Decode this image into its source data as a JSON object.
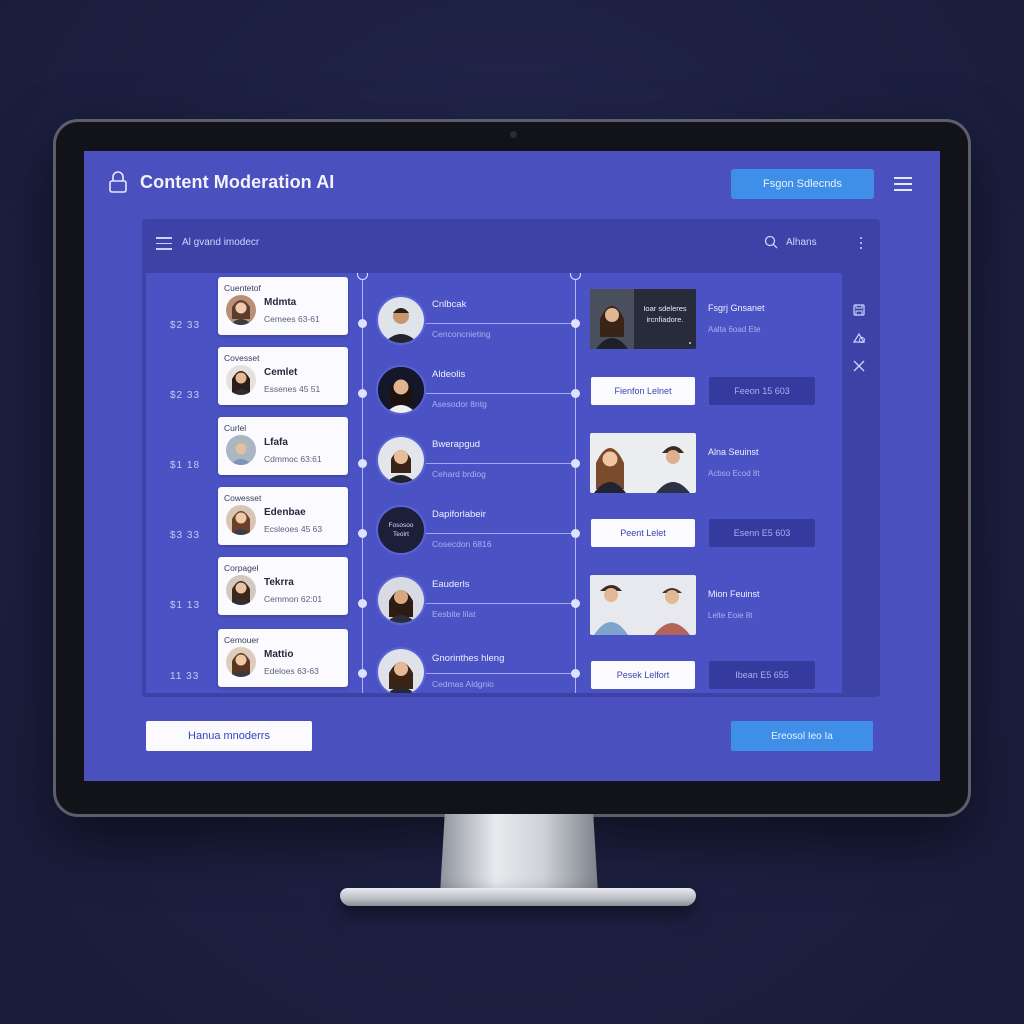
{
  "app": {
    "title": "Content Moderation AI"
  },
  "header": {
    "action_button": "Fsgon Sdlecnds",
    "menu_icon": "hamburger-icon",
    "lock_icon": "lock-icon"
  },
  "panel": {
    "title": "Al gvand imodecr",
    "search_label": "Alhans",
    "search_icon": "search-icon"
  },
  "rows": [
    {
      "time": "$2 33",
      "card_label": "Cuentetof",
      "card_name": "Mdmta",
      "card_meta": "Cemees 63-61",
      "mid_title": "Cnlbcak",
      "mid_sub": "Cenconcnieting"
    },
    {
      "time": "$2 33",
      "card_label": "Covesset",
      "card_name": "Cemlet",
      "card_meta": "Essenes 45 51",
      "mid_title": "Aldeolis",
      "mid_sub": "Asesodor 8ntg"
    },
    {
      "time": "$1 18",
      "card_label": "Curlel",
      "card_name": "Lfafa",
      "card_meta": "Cdmmoc 63:61",
      "mid_title": "Bwerapgud",
      "mid_sub": "Cehard brdiog"
    },
    {
      "time": "$3 33",
      "card_label": "Cowesset",
      "card_name": "Edenbae",
      "card_meta": "Ecsleoes 45 63",
      "mid_title": "Dapiforlabeir",
      "mid_sub": "Cosecdon 6816",
      "mid_badge": "Fososoo Teolrt"
    },
    {
      "time": "$1 13",
      "card_label": "Corpagel",
      "card_name": "Tekrra",
      "card_meta": "Cemmon 62:01",
      "mid_title": "Eauderls",
      "mid_sub": "Eesbite lilat"
    },
    {
      "time": "11 33",
      "card_label": "Cemouer",
      "card_name": "Mattio",
      "card_meta": "Edeloes 63-63",
      "mid_title": "Gnorinthes hleng",
      "mid_sub": "Cedmas Aldgnio"
    }
  ],
  "right": {
    "thumb1_text": [
      "Ioar sdeleres",
      "ircnfiadore."
    ],
    "thumb1_title": "Fsgrj Gnsanet",
    "thumb1_sub": "Aalta 6oad Ete",
    "btn1_white": "Fienfon Lelnet",
    "btn1_dark": "Feeon 15 603",
    "thumb2_title": "Alna Seuinst",
    "thumb2_sub": "Acbso Ecod 8t",
    "btn2_white": "Peent Lelet",
    "btn2_dark": "Esenn E5 603",
    "thumb3_title": "Mion Feuinst",
    "thumb3_sub": "Lelte Eoie 8t",
    "btn3_white": "Pesek Lelfort",
    "btn3_dark": "Ibean E5 655"
  },
  "side_icons": [
    "save-icon",
    "shape-icon",
    "close-icon"
  ],
  "footer": {
    "left_button": "Hanua mnoderrs",
    "right_button": "Ereosol Ieo Ia"
  },
  "colors": {
    "screen": "#4a50bd",
    "panel": "#3d43a6",
    "accent": "#3f8ee8"
  }
}
